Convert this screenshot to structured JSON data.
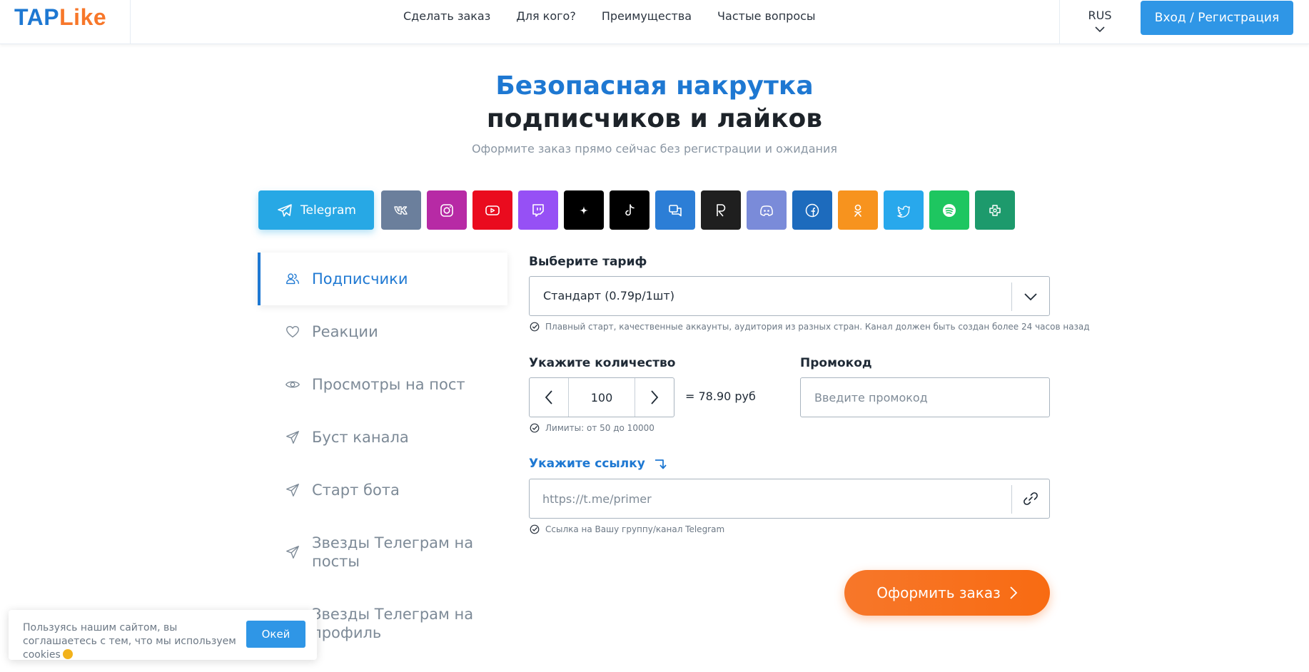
{
  "header": {
    "logo_tap": "TAP",
    "logo_like": "Like",
    "nav": [
      "Сделать заказ",
      "Для кого?",
      "Преимущества",
      "Частые вопросы"
    ],
    "lang": "RUS",
    "login_label": "Вход / Регистрация"
  },
  "hero": {
    "title_line1": "Безопасная накрутка",
    "title_line2": "подписчиков и лайков",
    "subtitle": "Оформите заказ прямо сейчас без регистрации и ожидания"
  },
  "platforms": {
    "active_label": "Telegram",
    "items": [
      {
        "name": "telegram",
        "color": "#27a8e5"
      },
      {
        "name": "vk",
        "color": "#6b7f9c"
      },
      {
        "name": "instagram",
        "color": "#b72aa5"
      },
      {
        "name": "youtube",
        "color": "#ea0b1e"
      },
      {
        "name": "twitch",
        "color": "#9650f5"
      },
      {
        "name": "ai-sparkle",
        "color": "#000000"
      },
      {
        "name": "tiktok",
        "color": "#000000"
      },
      {
        "name": "chat",
        "color": "#2c7ed6"
      },
      {
        "name": "rutube",
        "color": "#1f1f1f"
      },
      {
        "name": "discord",
        "color": "#7a8bd9"
      },
      {
        "name": "facebook",
        "color": "#1d6bbd"
      },
      {
        "name": "odnoklassniki",
        "color": "#f7931e"
      },
      {
        "name": "twitter",
        "color": "#28a8ec"
      },
      {
        "name": "spotify",
        "color": "#1ec660"
      },
      {
        "name": "threads",
        "color": "#1d9a6c"
      }
    ]
  },
  "menu": [
    {
      "label": "Подписчики",
      "icon": "users-icon",
      "active": true
    },
    {
      "label": "Реакции",
      "icon": "heart-icon"
    },
    {
      "label": "Просмотры на пост",
      "icon": "eye-icon"
    },
    {
      "label": "Буст канала",
      "icon": "send-icon"
    },
    {
      "label": "Старт бота",
      "icon": "send-icon"
    },
    {
      "label": "Звезды Телеграм на посты",
      "icon": "send-icon"
    },
    {
      "label": "Звезды Телеграм на профиль",
      "icon": "send-icon"
    }
  ],
  "form": {
    "tariff_label": "Выберите тариф",
    "tariff_value": "Стандарт (0.79р/1шт)",
    "tariff_hint": "Плавный старт, качественные аккаунты, аудитория из разных стран. Канал должен быть создан более 24 часов назад",
    "quantity_label": "Укажите количество",
    "quantity_value": "100",
    "price_text": "= 78.90 руб",
    "quantity_hint": "Лимиты: от 50 до 10000",
    "promo_label": "Промокод",
    "promo_placeholder": "Введите промокод",
    "link_label": "Укажите ссылку",
    "link_placeholder": "https://t.me/primer",
    "link_hint": "Ссылка на Вашу группу/канал Telegram",
    "submit_label": "Оформить заказ"
  },
  "cookie": {
    "text": "Пользуясь нашим сайтом, вы соглашаетесь с тем, что мы используем cookies",
    "ok_label": "Окей"
  },
  "colors": {
    "primary": "#1e78d2",
    "button_blue": "#2f96e6",
    "accent_orange": "#f7772a"
  }
}
